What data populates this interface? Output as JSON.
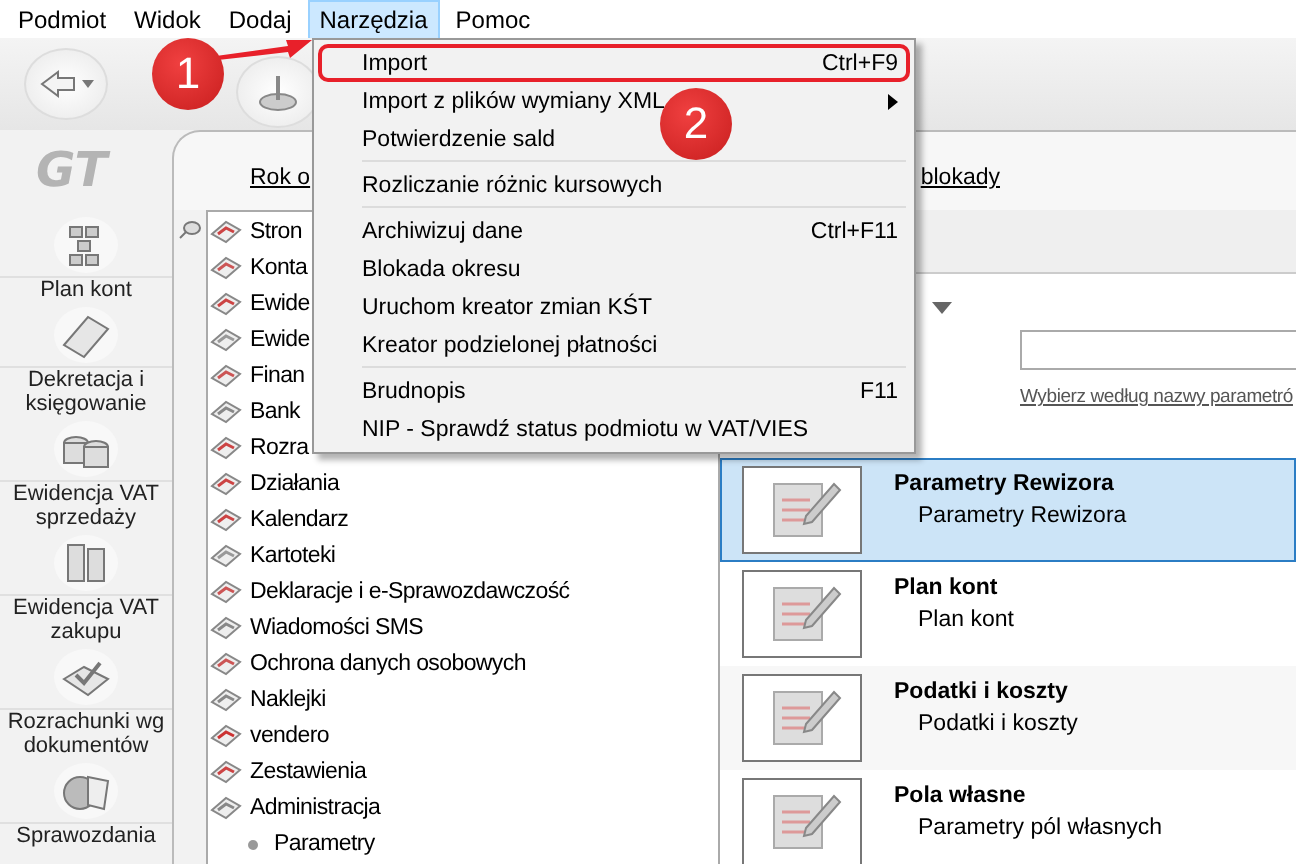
{
  "menu_bar": [
    {
      "label": "Podmiot",
      "selected": false
    },
    {
      "label": "Widok",
      "selected": false
    },
    {
      "label": "Dodaj",
      "selected": false
    },
    {
      "label": "Narzędzia",
      "selected": true
    },
    {
      "label": "Pomoc",
      "selected": false
    }
  ],
  "logo": "GT",
  "nav": [
    {
      "label": "Plan kont"
    },
    {
      "label": "Dekretacja i księgowanie"
    },
    {
      "label": "Ewidencja VAT sprzedaży"
    },
    {
      "label": "Ewidencja VAT zakupu"
    },
    {
      "label": "Rozrachunki wg dokumentów"
    },
    {
      "label": "Sprawozdania"
    }
  ],
  "header_links": [
    "Rok o",
    "blokady"
  ],
  "tree": [
    {
      "label": "Stron"
    },
    {
      "label": "Konta"
    },
    {
      "label": "Ewide"
    },
    {
      "label": "Ewide"
    },
    {
      "label": "Finan"
    },
    {
      "label": "Bank"
    },
    {
      "label": "Rozra"
    },
    {
      "label": "Działania"
    },
    {
      "label": "Kalendarz"
    },
    {
      "label": "Kartoteki"
    },
    {
      "label": "Deklaracje i e-Sprawozdawczość"
    },
    {
      "label": "Wiadomości SMS"
    },
    {
      "label": "Ochrona danych osobowych"
    },
    {
      "label": "Naklejki"
    },
    {
      "label": "vendero"
    },
    {
      "label": "Zestawienia"
    },
    {
      "label": "Administracja",
      "children": [
        {
          "label": "Parametry"
        }
      ]
    }
  ],
  "params": {
    "hint": "Wybierz według nazwy parametró",
    "items": [
      {
        "title": "Parametry Rewizora",
        "subtitle": "Parametry Rewizora",
        "selected": true
      },
      {
        "title": "Plan kont",
        "subtitle": "Plan kont",
        "selected": false
      },
      {
        "title": "Podatki i koszty",
        "subtitle": "Podatki i koszty",
        "selected": false
      },
      {
        "title": "Pola własne",
        "subtitle": "Parametry pól własnych",
        "selected": false
      }
    ]
  },
  "dropdown": {
    "items": [
      {
        "kind": "item",
        "label": "Import",
        "shortcut": "Ctrl+F9",
        "submenu": false,
        "annotated": true
      },
      {
        "kind": "item",
        "label": "Import z plików wymiany XML",
        "submenu": true,
        "annotated": false
      },
      {
        "kind": "item",
        "label": "Potwierdzenie sald",
        "submenu": false,
        "annotated": false
      },
      {
        "kind": "separator"
      },
      {
        "kind": "item",
        "label": "Rozliczanie różnic kursowych",
        "submenu": false,
        "annotated": false
      },
      {
        "kind": "separator"
      },
      {
        "kind": "item",
        "label": "Archiwizuj dane",
        "shortcut": "Ctrl+F11",
        "submenu": false,
        "annotated": false
      },
      {
        "kind": "item",
        "label": "Blokada okresu",
        "submenu": false,
        "annotated": false
      },
      {
        "kind": "item",
        "label": "Uruchom kreator zmian KŚT",
        "submenu": false,
        "annotated": false
      },
      {
        "kind": "item",
        "label": "Kreator podzielonej płatności",
        "submenu": false,
        "annotated": false
      },
      {
        "kind": "separator"
      },
      {
        "kind": "item",
        "label": "Brudnopis",
        "shortcut": "F11",
        "submenu": false,
        "annotated": false
      },
      {
        "kind": "item",
        "label": "NIP - Sprawdź status podmiotu w VAT/VIES",
        "submenu": false,
        "annotated": false
      }
    ]
  },
  "annotations": [
    {
      "label": "1"
    },
    {
      "label": "2"
    }
  ]
}
